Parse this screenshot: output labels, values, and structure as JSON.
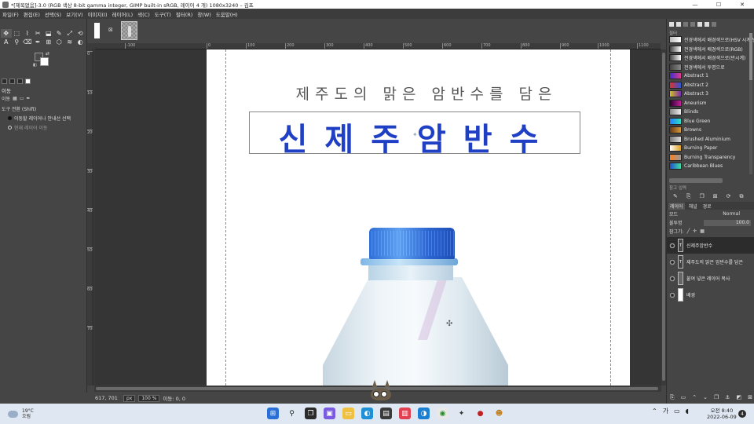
{
  "window": {
    "title": "*[제목없음]-3.0 (RGB 색상 8-bit gamma integer, GIMP built-in sRGB, 레이어 4 개) 1080x3240 – 김프",
    "minimize_glyph": "—",
    "maximize_glyph": "☐",
    "close_glyph": "✕"
  },
  "menubar": {
    "items": [
      "파일(F)",
      "편집(E)",
      "선택(S)",
      "보기(V)",
      "이미지(I)",
      "레이어(L)",
      "색(C)",
      "도구(T)",
      "필터(R)",
      "창(W)",
      "도움말(H)"
    ]
  },
  "toolbox": {
    "tools": [
      "✥",
      "⬚",
      "⌇",
      "✂",
      "⬓",
      "✎",
      "⤢",
      "⟲",
      "A",
      "⚲",
      "⌫",
      "✒",
      "⊞",
      "⬡",
      "≋",
      "◐"
    ],
    "options": {
      "heading": "이동",
      "subtab1": "이동",
      "switch_line": "도구 전환  (Shift)",
      "radio1": "이동할 레이어나 안내선 선택",
      "radio2": "현재 레이어 이동"
    }
  },
  "ruler": {
    "h_ticks": [
      "-100",
      "0",
      "100",
      "200",
      "300",
      "400",
      "500",
      "600",
      "700",
      "800",
      "900",
      "1000",
      "1100"
    ],
    "v_ticks": [
      "0",
      "100",
      "200",
      "300",
      "400",
      "500",
      "600",
      "700"
    ]
  },
  "canvas": {
    "subtitle": "제주도의 맑은 암반수를 담은",
    "title": "신제주암반수",
    "title_color": "#1f3fc5",
    "crosshair_glyph": "✦",
    "move_cursor_glyph": "✣"
  },
  "statusbar": {
    "coords": "617, 701",
    "unit": "px",
    "zoom": "100 %",
    "message": "이동: 0, 0"
  },
  "dock": {
    "gradients_label": "필터",
    "gradients": [
      {
        "name": "전경색에서 배경색으로(HSV 시계 방향)",
        "colors": [
          "#bbbbbb",
          "#ffffff"
        ]
      },
      {
        "name": "전경색에서 배경색으로(RGB)",
        "colors": [
          "#444444",
          "#ffffff"
        ]
      },
      {
        "name": "전경색에서 배경색으로(반시계)",
        "colors": [
          "#444444",
          "#ffffff"
        ]
      },
      {
        "name": "전경색에서 투명으로",
        "colors": [
          "#444444",
          "#888888"
        ]
      },
      {
        "name": "Abstract 1",
        "colors": [
          "#3b2fd0",
          "#e23b8a"
        ]
      },
      {
        "name": "Abstract 2",
        "colors": [
          "#e03030",
          "#2b55d6"
        ]
      },
      {
        "name": "Abstract 3",
        "colors": [
          "#d4c020",
          "#7a2bb0"
        ]
      },
      {
        "name": "Aneurism",
        "colors": [
          "#2a0030",
          "#c0209a"
        ]
      },
      {
        "name": "Blinds",
        "colors": [
          "#888888",
          "#eeeeee"
        ]
      },
      {
        "name": "Blue Green",
        "colors": [
          "#2080ff",
          "#30e0c0"
        ]
      },
      {
        "name": "Browns",
        "colors": [
          "#6a3a10",
          "#d49a40"
        ]
      },
      {
        "name": "Brushed Aluminium",
        "colors": [
          "#777777",
          "#dddddd"
        ]
      },
      {
        "name": "Burning Paper",
        "colors": [
          "#ffffff",
          "#e0a020"
        ]
      },
      {
        "name": "Burning Transparency",
        "colors": [
          "#ff8020",
          "#999999"
        ]
      },
      {
        "name": "Caribbean Blues",
        "colors": [
          "#2050d0",
          "#40e0a0"
        ]
      }
    ],
    "gradient_sub": "참고 입력",
    "layers_tabs": [
      "레이어",
      "채널",
      "경로"
    ],
    "mode_label": "모드",
    "mode_value": "Normal",
    "opacity_label": "불투명",
    "opacity_value": "100.0",
    "lock_label": "잠그기:",
    "layers": [
      {
        "name": "신제주암반수",
        "selected": true,
        "thumb": "text"
      },
      {
        "name": "제주도의 맑은 암반수를 담은",
        "selected": false,
        "thumb": "text"
      },
      {
        "name": "붙여 넣은 레이어 복사",
        "selected": false,
        "thumb": "copy"
      },
      {
        "name": "배경",
        "selected": false,
        "thumb": "white"
      }
    ]
  },
  "taskbar": {
    "temp": "19°C",
    "weather": "흐림",
    "time": "오전 8:40",
    "date": "2022-06-09",
    "notifications": "4",
    "tray_ime": "가"
  }
}
